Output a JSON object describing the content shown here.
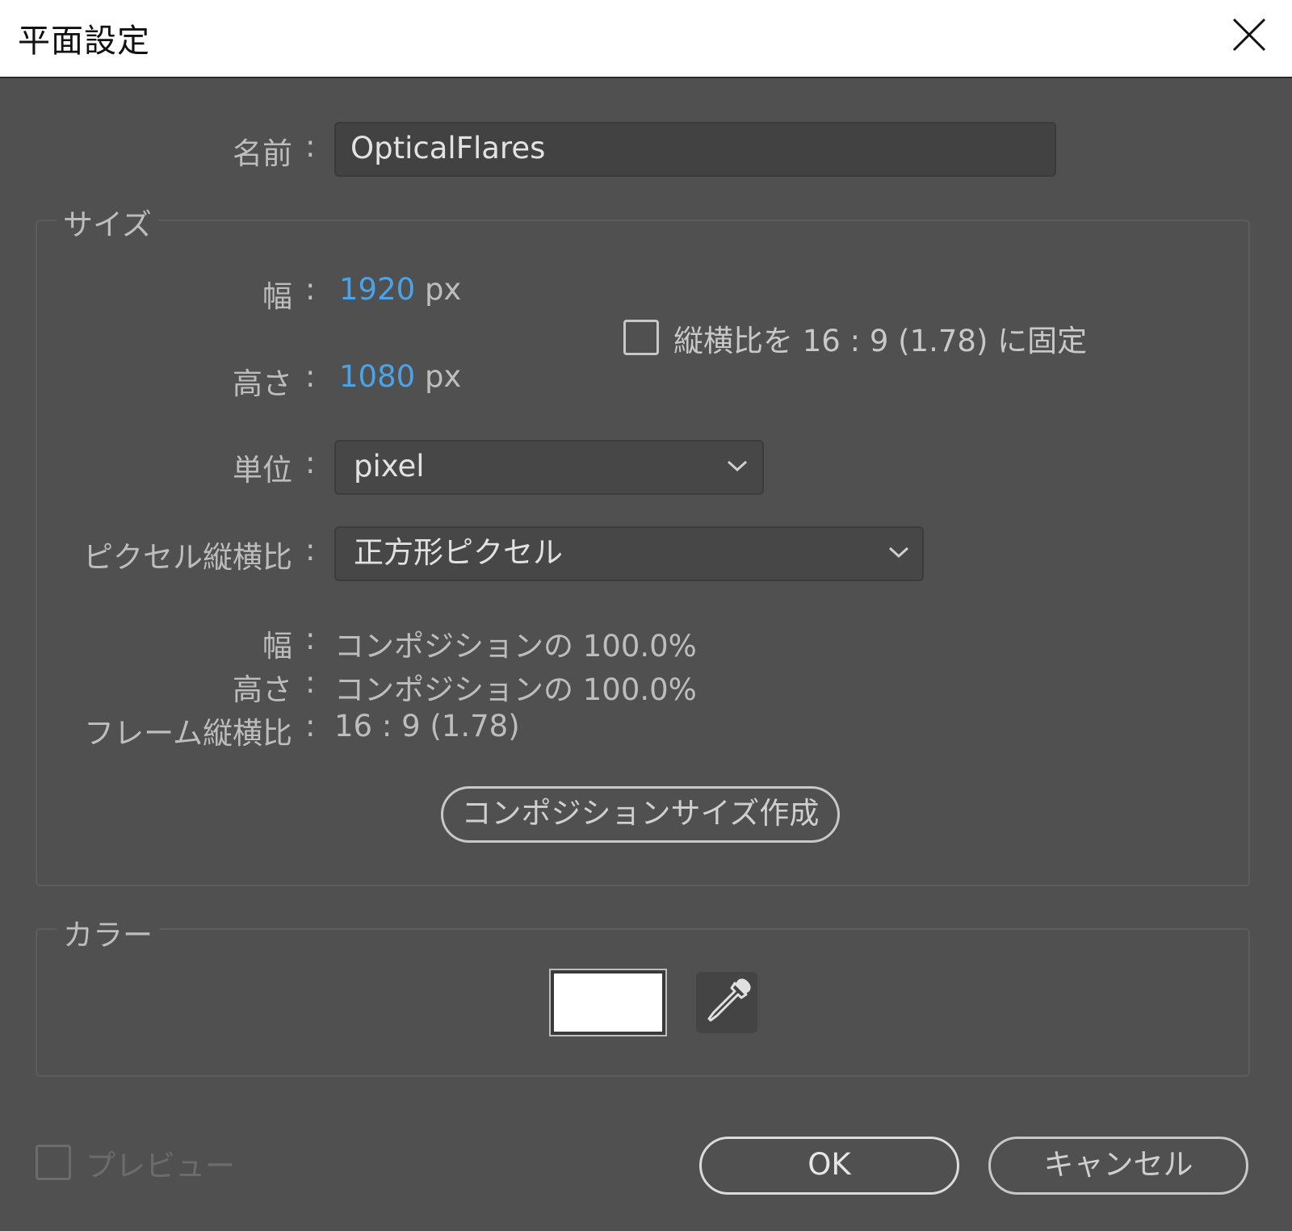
{
  "window": {
    "title": "平面設定"
  },
  "name_field": {
    "label": "名前",
    "colon": ":",
    "value": "OpticalFlares"
  },
  "size_group": {
    "title": "サイズ",
    "width": {
      "label": "幅",
      "colon": ":",
      "value": "1920",
      "unit": "px"
    },
    "height": {
      "label": "高さ",
      "colon": ":",
      "value": "1080",
      "unit": "px"
    },
    "lock_aspect": {
      "checked": false,
      "label": "縦横比を 16 : 9 (1.78) に固定"
    },
    "units": {
      "label": "単位",
      "colon": ":",
      "selected": "pixel"
    },
    "pixel_aspect": {
      "label": "ピクセル縦横比",
      "colon": ":",
      "selected": "正方形ピクセル"
    },
    "info": {
      "width_label": "幅",
      "width_value": "コンポジションの 100.0%",
      "height_label": "高さ",
      "height_value": "コンポジションの 100.0%",
      "frame_label": "フレーム縦横比",
      "frame_value": "16 : 9 (1.78)",
      "colon": ":"
    },
    "make_comp_size_button": "コンポジションサイズ作成"
  },
  "color_group": {
    "title": "カラー",
    "swatch_color": "#ffffff",
    "eyedropper_icon": "eyedropper-icon"
  },
  "footer": {
    "preview": {
      "label": "プレビュー",
      "checked": false,
      "enabled": false
    },
    "ok_label": "OK",
    "cancel_label": "キャンセル"
  },
  "colors": {
    "background": "#505050",
    "value_blue": "#4aa3e8",
    "titlebar": "#ffffff"
  }
}
